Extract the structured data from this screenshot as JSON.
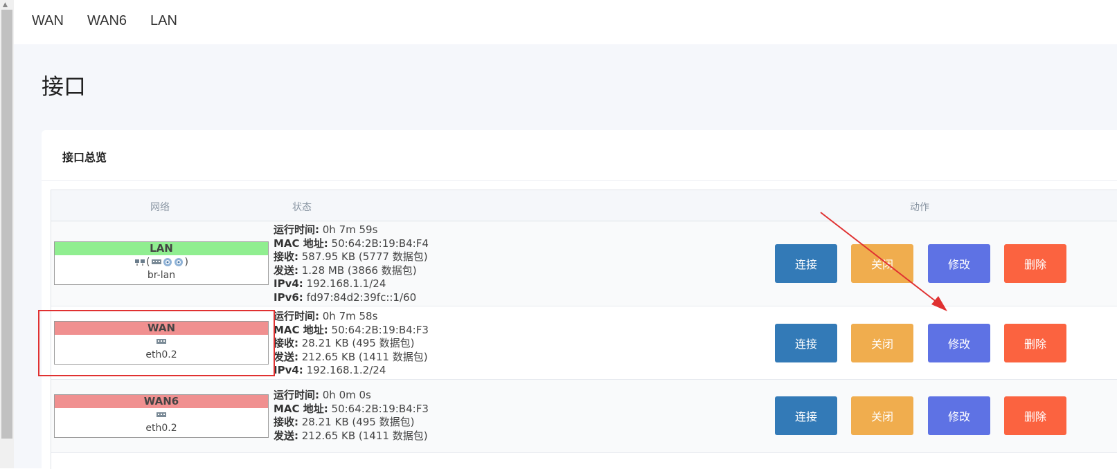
{
  "tabs": [
    "WAN",
    "WAN6",
    "LAN"
  ],
  "page_title": "接口",
  "card_title": "接口总览",
  "table_headers": {
    "network": "网络",
    "status": "状态",
    "actions": "动作"
  },
  "actions": {
    "connect": "连接",
    "stop": "关闭",
    "edit": "修改",
    "delete": "删除"
  },
  "colors": {
    "lan": "#90ee90",
    "wan": "#f09090",
    "wan6": "#f09090",
    "connect": "#337ab7",
    "stop": "#f0ad4e",
    "edit": "#5e72e4",
    "delete": "#fb6340",
    "annotation": "#e03131"
  },
  "interfaces": [
    {
      "name": "LAN",
      "icons": [
        "bridge-icon",
        "switch-icon",
        "wifi-icon",
        "wifi-icon"
      ],
      "paren_open": "(",
      "paren_close": ")",
      "device": "br-lan",
      "status": [
        {
          "label": "运行时间:",
          "value": " 0h 7m 59s"
        },
        {
          "label": "MAC 地址:",
          "value": " 50:64:2B:19:B4:F4"
        },
        {
          "label": "接收:",
          "value": " 587.95 KB (5777 数据包)"
        },
        {
          "label": "发送:",
          "value": " 1.28 MB (3866 数据包)"
        },
        {
          "label": "IPv4:",
          "value": " 192.168.1.1/24"
        },
        {
          "label": "IPv6:",
          "value": " fd97:84d2:39fc::1/60"
        }
      ]
    },
    {
      "name": "WAN",
      "icons": [
        "switch-icon"
      ],
      "device": "eth0.2",
      "status": [
        {
          "label": "运行时间:",
          "value": " 0h 7m 58s"
        },
        {
          "label": "MAC 地址:",
          "value": " 50:64:2B:19:B4:F3"
        },
        {
          "label": "接收:",
          "value": " 28.21 KB (495 数据包)"
        },
        {
          "label": "发送:",
          "value": " 212.65 KB (1411 数据包)"
        },
        {
          "label": "IPv4:",
          "value": " 192.168.1.2/24"
        }
      ]
    },
    {
      "name": "WAN6",
      "icons": [
        "switch-icon"
      ],
      "device": "eth0.2",
      "status": [
        {
          "label": "运行时间:",
          "value": " 0h 0m 0s"
        },
        {
          "label": "MAC 地址:",
          "value": " 50:64:2B:19:B4:F3"
        },
        {
          "label": "接收:",
          "value": " 28.21 KB (495 数据包)"
        },
        {
          "label": "发送:",
          "value": " 212.65 KB (1411 数据包)"
        }
      ]
    }
  ]
}
